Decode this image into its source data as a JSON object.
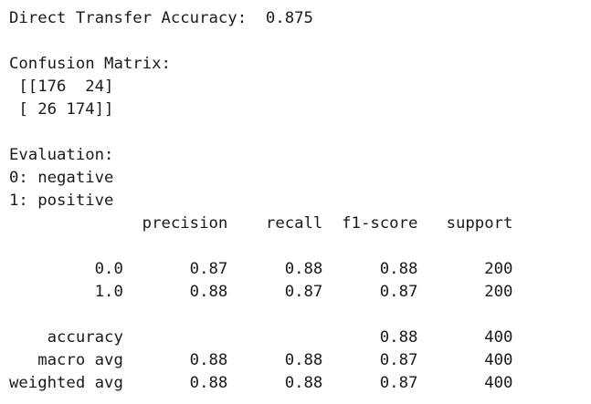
{
  "output": {
    "accuracy_line": "Direct Transfer Accuracy:  0.875",
    "confusion_title": "Confusion Matrix:",
    "matrix_row_1": " [[176  24]",
    "matrix_row_2": " [ 26 174]]",
    "evaluation_title": "Evaluation:",
    "label_map_0": "0: negative",
    "label_map_1": "1: positive",
    "report_header": "              precision    recall  f1-score   support",
    "report_row_0": "         0.0       0.87      0.88      0.88       200",
    "report_row_1": "         1.0       0.88      0.87      0.87       200",
    "report_accuracy": "    accuracy                           0.88       400",
    "report_macro_avg": "   macro avg       0.88      0.88      0.87       400",
    "report_weighted_avg": "weighted avg       0.88      0.88      0.87       400"
  }
}
